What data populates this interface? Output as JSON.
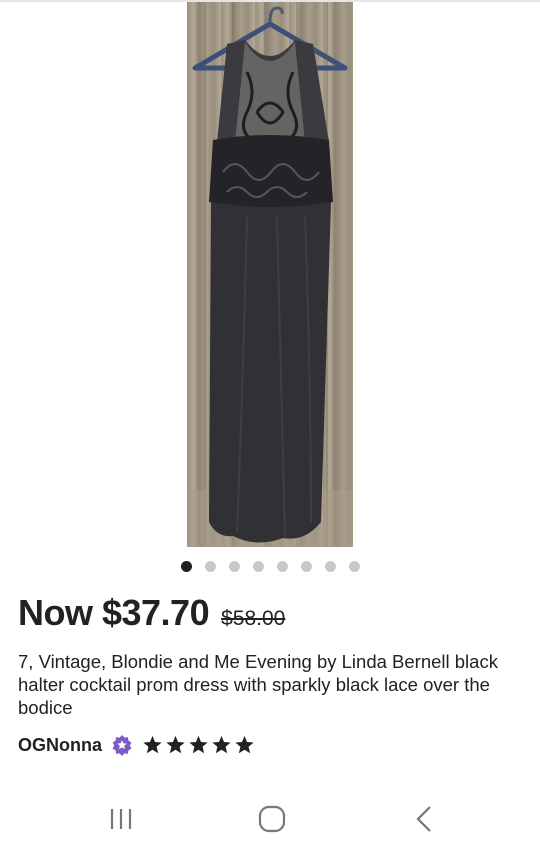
{
  "product": {
    "price_now": "Now $37.70",
    "price_original": "$58.00",
    "title": "7, Vintage, Blondie and Me Evening by Linda Bernell black halter cocktail prom dress with sparkly black lace over the bodice"
  },
  "carousel": {
    "total": 8,
    "active": 1
  },
  "seller": {
    "name": "OGNonna",
    "badge_icon": "star-seller-badge-icon",
    "badge_color": "#7f5ac9",
    "rating": 5
  },
  "navbar": {
    "icons": [
      "recent-apps-icon",
      "home-icon",
      "back-icon"
    ]
  }
}
